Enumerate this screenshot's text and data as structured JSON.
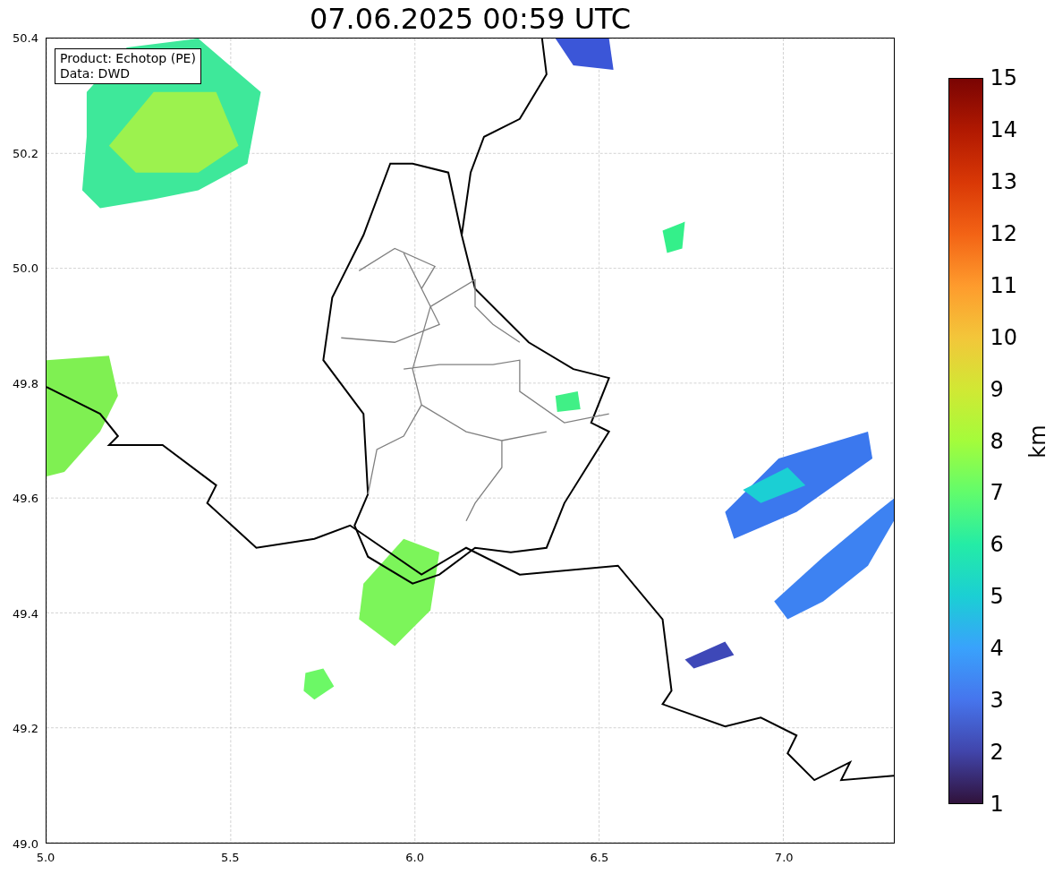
{
  "title": "07.06.2025 00:59 UTC",
  "info_box": [
    "Product: Echotop (PE)",
    "Data: DWD"
  ],
  "x_ticks": [
    "5.0",
    "5.5",
    "6.0",
    "6.5",
    "7.0"
  ],
  "y_ticks": [
    "50.4",
    "50.2",
    "50.0",
    "49.8",
    "49.6",
    "49.4",
    "49.2",
    "49.0"
  ],
  "colorbar": {
    "label": "km",
    "ticks": [
      "15",
      "14",
      "13",
      "12",
      "11",
      "10",
      "9",
      "8",
      "7",
      "6",
      "5",
      "4",
      "3",
      "2",
      "1"
    ]
  }
}
